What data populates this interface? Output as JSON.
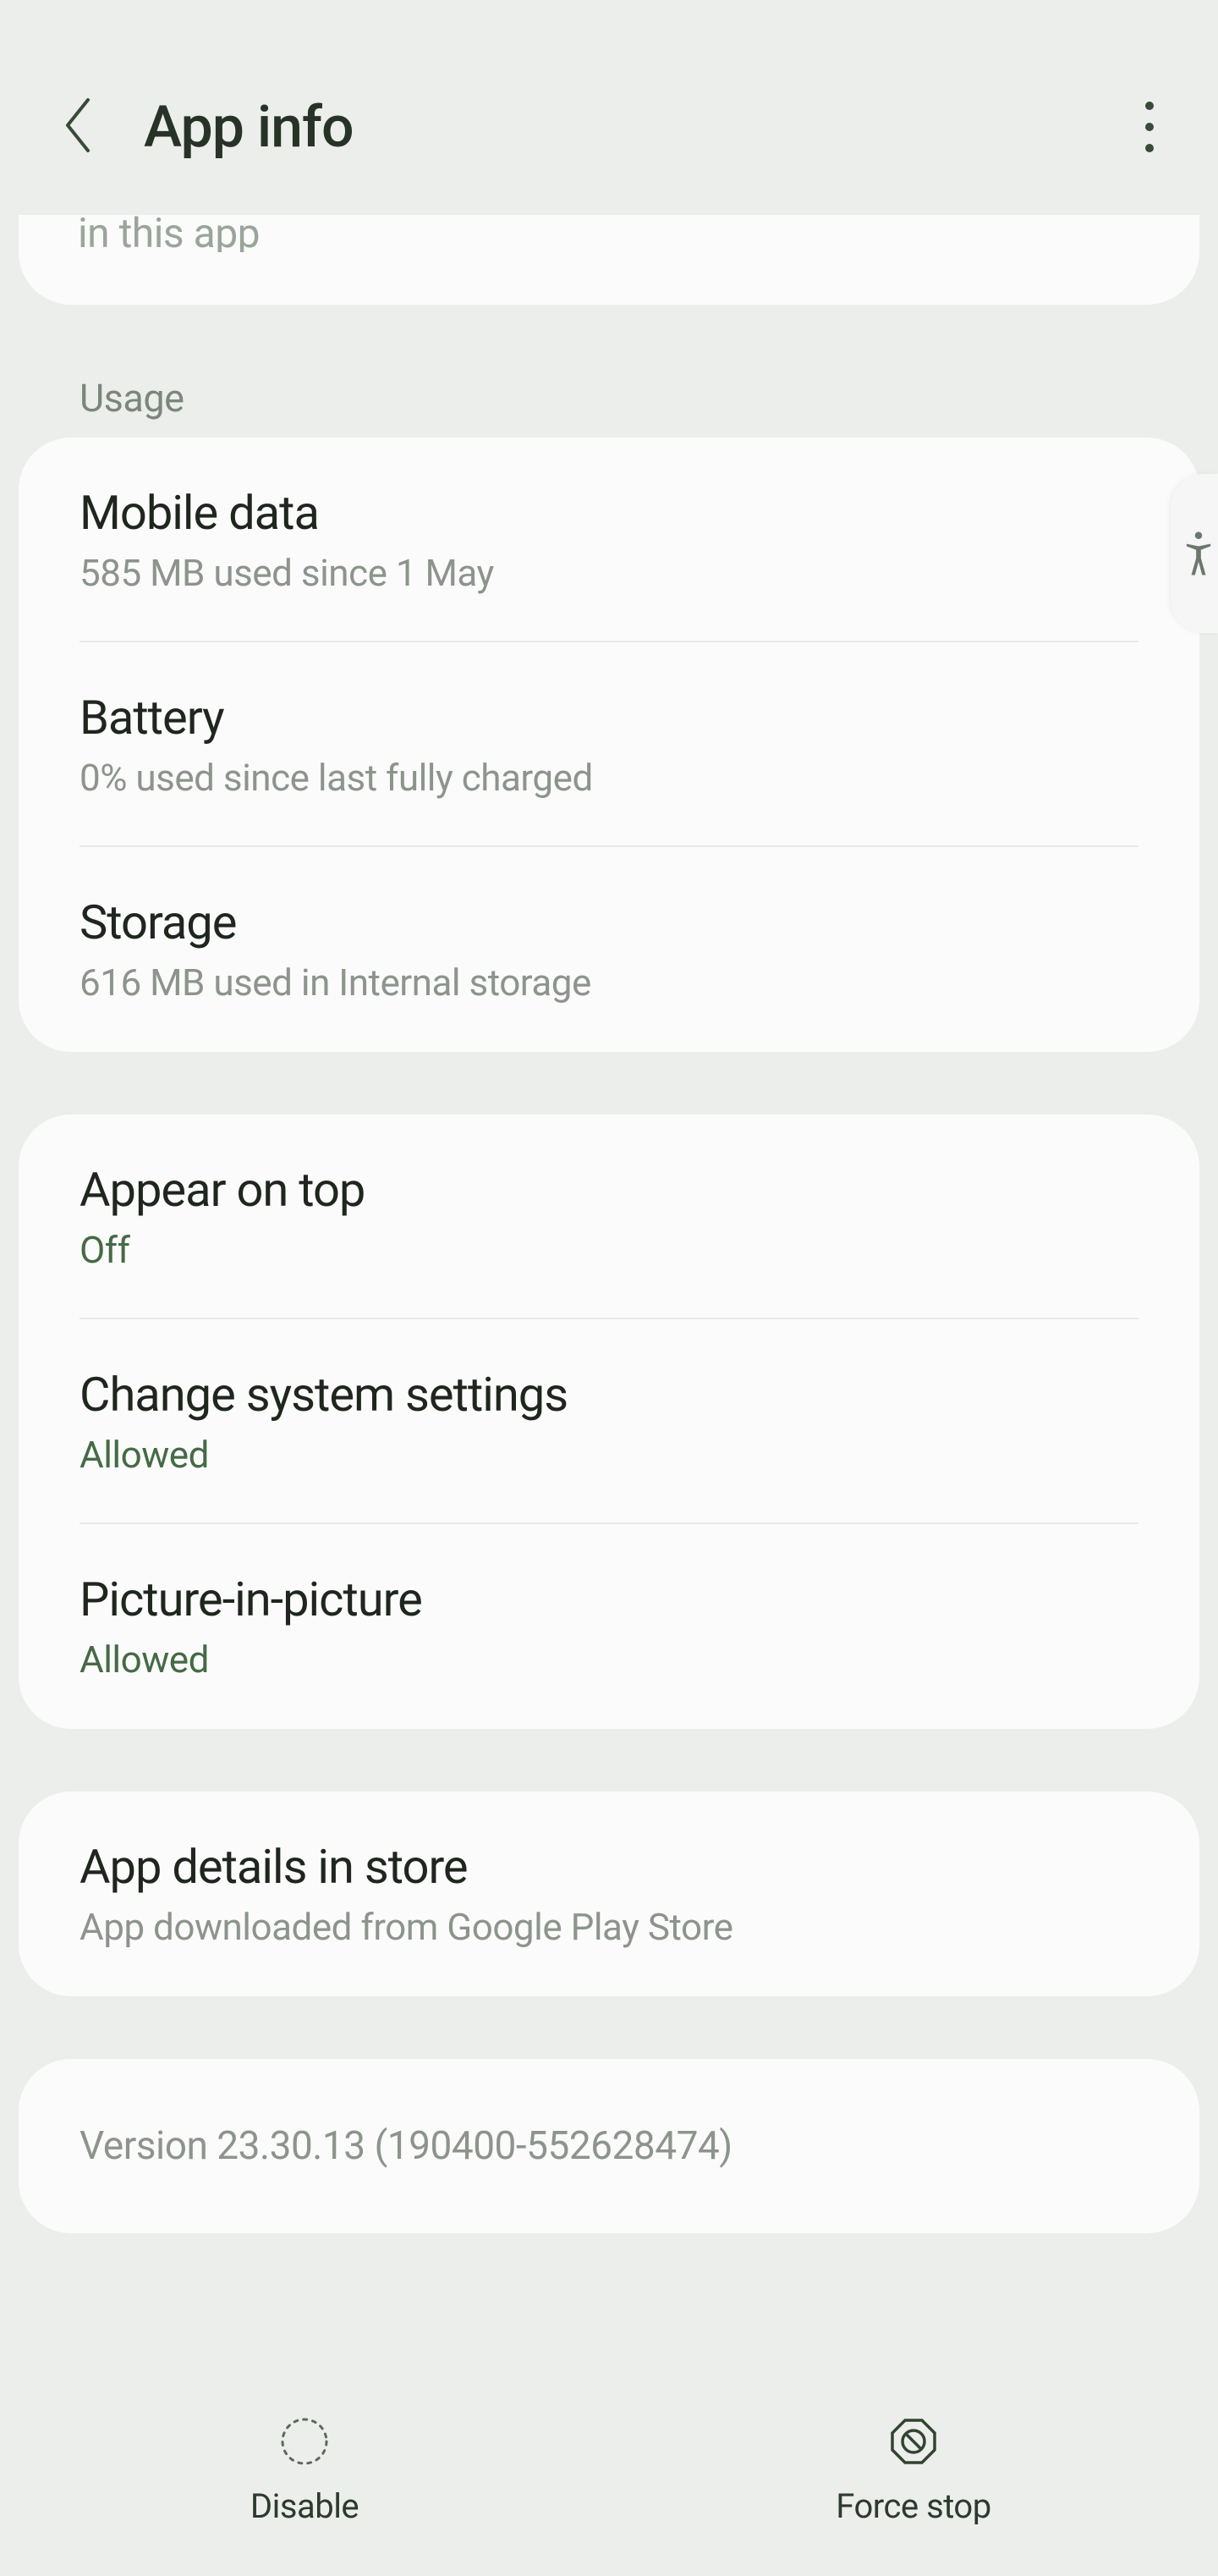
{
  "toolbar": {
    "title": "App info"
  },
  "peek": {
    "text": "in this app"
  },
  "sections": {
    "usage_label": "Usage"
  },
  "usage": {
    "mobile_data": {
      "title": "Mobile data",
      "sub": "585 MB used since 1 May"
    },
    "battery": {
      "title": "Battery",
      "sub": "0% used since last fully charged"
    },
    "storage": {
      "title": "Storage",
      "sub": "616 MB used in Internal storage"
    }
  },
  "advanced": {
    "appear_on_top": {
      "title": "Appear on top",
      "sub": "Off"
    },
    "change_system": {
      "title": "Change system settings",
      "sub": "Allowed"
    },
    "pip": {
      "title": "Picture-in-picture",
      "sub": "Allowed"
    }
  },
  "store": {
    "title": "App details in store",
    "sub": "App downloaded from Google Play Store"
  },
  "version": {
    "text": "Version 23.30.13 (190400-552628474)"
  },
  "bottom": {
    "disable": "Disable",
    "force_stop": "Force stop"
  }
}
